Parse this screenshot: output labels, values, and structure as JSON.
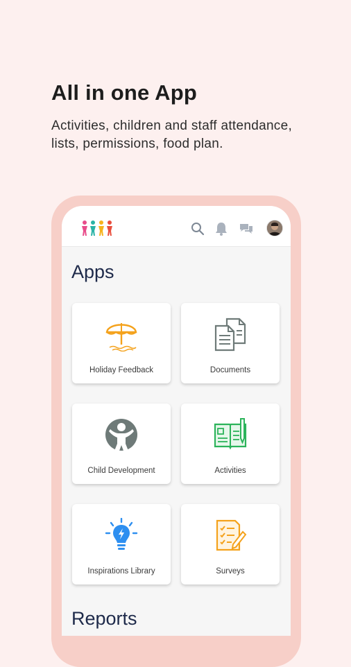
{
  "promo": {
    "headline": "All in one App",
    "subline": "Activities, children and staff attendance, lists, permissions, food plan."
  },
  "app": {
    "topbar": {
      "logo": "kids-logo",
      "icons": [
        "search-icon",
        "bell-icon",
        "chat-icon"
      ],
      "avatar": "user-avatar"
    },
    "apps_section": {
      "title": "Apps",
      "tiles": [
        {
          "label": "Holiday Feedback",
          "icon": "beach-umbrella-icon",
          "color": "#f4a21c"
        },
        {
          "label": "Documents",
          "icon": "documents-icon",
          "color": "#6e7a78"
        },
        {
          "label": "Child Development",
          "icon": "child-development-icon",
          "color": "#6e7a78"
        },
        {
          "label": "Activities",
          "icon": "book-pen-icon",
          "color": "#2bb35a"
        },
        {
          "label": "Inspirations Library",
          "icon": "lightbulb-icon",
          "color": "#2e8ff0"
        },
        {
          "label": "Surveys",
          "icon": "survey-icon",
          "color": "#f4a21c"
        }
      ]
    },
    "reports_section": {
      "title": "Reports"
    }
  }
}
